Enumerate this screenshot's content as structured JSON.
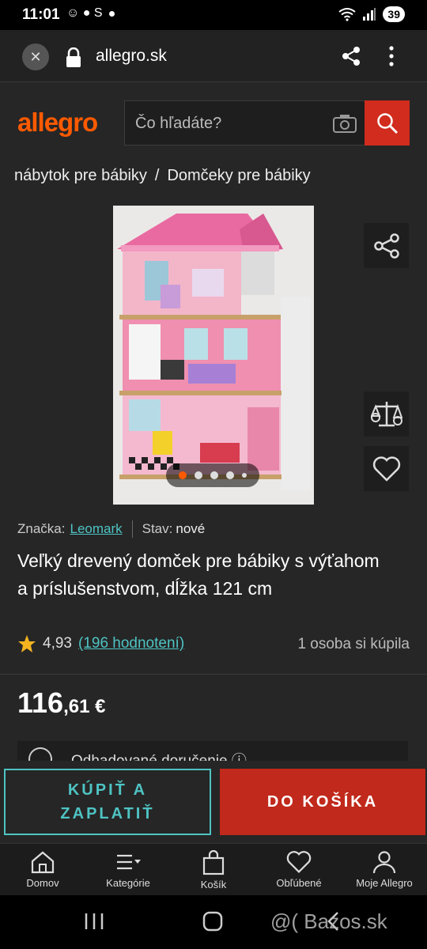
{
  "status": {
    "time": "11:01",
    "left_icons": "☺ ● S",
    "battery": "39"
  },
  "browser": {
    "url": "allegro.sk"
  },
  "header": {
    "logo": "allegro",
    "search_placeholder": "Čo hľadáte?"
  },
  "breadcrumb": {
    "item1": "nábytok pre bábiky",
    "separator": "/",
    "item2": "Domčeky pre bábiky"
  },
  "product": {
    "brand_label": "Značka:",
    "brand": "Leomark",
    "condition_label": "Stav:",
    "condition": "nové",
    "title": "Veľký drevený domček pre bábiky s výťahom a príslušenstvom, dĺžka 121 cm",
    "rating": "4,93",
    "reviews": "(196 hodnotení)",
    "bought": "1 osoba si kúpila",
    "price_main": "116",
    "price_cents": ",61 €",
    "delivery": "Odhadované doručenie ⓘ",
    "image_count": 5,
    "image_active": 1
  },
  "actions": {
    "buy_now": "KÚPIŤ A ZAPLATIŤ",
    "add_to_cart": "DO KOŠÍKA"
  },
  "nav": {
    "home": "Domov",
    "categories": "Kategórie",
    "cart": "Košík",
    "favorites": "Obľúbené",
    "account": "Moje Allegro"
  },
  "watermark": "@( Bazos.sk",
  "colors": {
    "brand": "#ff5a00",
    "accent": "#4fc3c3",
    "cart": "#c0291b",
    "search_btn": "#d12c1e"
  }
}
